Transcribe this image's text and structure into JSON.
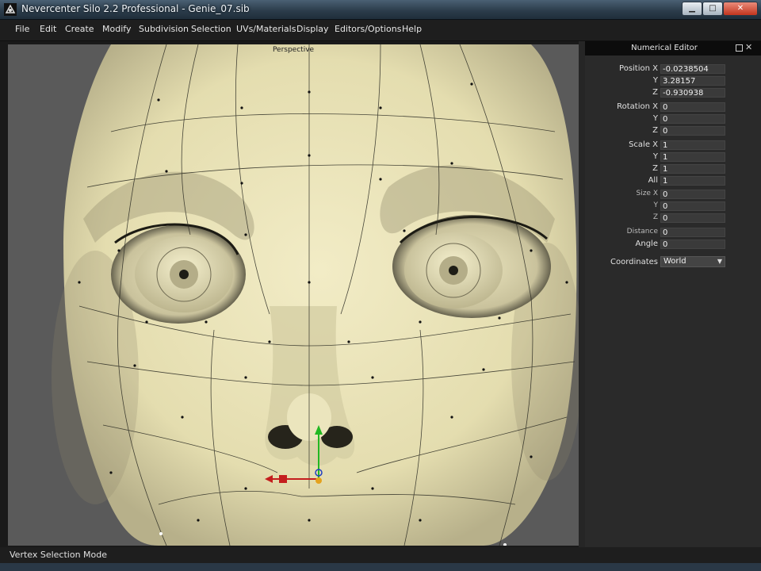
{
  "window": {
    "title": "Nevercenter Silo 2.2 Professional - Genie_07.sib",
    "min_glyph": "▁",
    "max_glyph": "□",
    "close_glyph": "✕"
  },
  "menu": [
    "File",
    "Edit",
    "Create",
    "Modify",
    "Subdivision",
    "Selection",
    "UVs/Materials",
    "Display",
    "Editors/Options",
    "Help"
  ],
  "viewport": {
    "label": "Perspective",
    "model": "3D head mesh with vertex wireframe and transform manipulator",
    "colors": {
      "mesh": "#e6e0b4",
      "background": "#5a5a5a",
      "wire": "#2a2a22"
    }
  },
  "numerical_editor": {
    "title": "Numerical Editor",
    "float_icon": "float-window-icon",
    "close_glyph": "✕",
    "position": {
      "label_x": "Position X",
      "label_y": "Y",
      "label_z": "Z",
      "x": "-0.0238504",
      "y": "3.28157",
      "z": "-0.930938"
    },
    "rotation": {
      "label_x": "Rotation X",
      "label_y": "Y",
      "label_z": "Z",
      "x": "0",
      "y": "0",
      "z": "0"
    },
    "scale": {
      "label_x": "Scale X",
      "label_y": "Y",
      "label_z": "Z",
      "label_all": "All",
      "x": "1",
      "y": "1",
      "z": "1",
      "all": "1"
    },
    "size": {
      "label_x": "Size X",
      "label_y": "Y",
      "label_z": "Z",
      "x": "0",
      "y": "0",
      "z": "0"
    },
    "distance": {
      "label": "Distance",
      "value": "0"
    },
    "angle": {
      "label": "Angle",
      "value": "0"
    },
    "coordinates": {
      "label": "Coordinates",
      "value": "World",
      "arrow": "▼"
    }
  },
  "status": {
    "text": "Vertex Selection Mode"
  }
}
